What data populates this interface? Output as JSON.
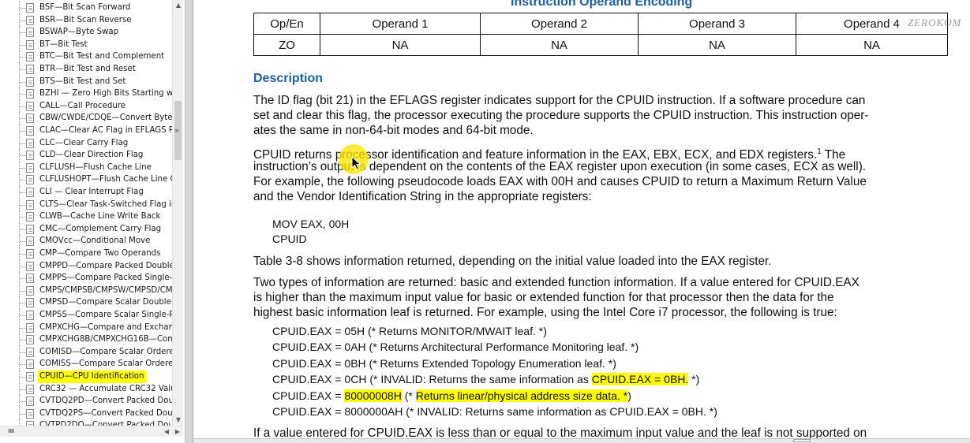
{
  "sidebar": {
    "items": [
      {
        "label": "BSF—Bit Scan Forward"
      },
      {
        "label": "BSR—Bit Scan Reverse"
      },
      {
        "label": "BSWAP—Byte Swap"
      },
      {
        "label": "BT—Bit Test"
      },
      {
        "label": "BTC—Bit Test and Complement"
      },
      {
        "label": "BTR—Bit Test and Reset"
      },
      {
        "label": "BTS—Bit Test and Set"
      },
      {
        "label": "BZHI — Zero High Bits Starting with"
      },
      {
        "label": "CALL—Call Procedure"
      },
      {
        "label": "CBW/CWDE/CDQE—Convert Byte t"
      },
      {
        "label": "CLAC—Clear AC Flag in EFLAGS Reg"
      },
      {
        "label": "CLC—Clear Carry Flag"
      },
      {
        "label": "CLD—Clear Direction Flag"
      },
      {
        "label": "CLFLUSH—Flush Cache Line"
      },
      {
        "label": "CLFLUSHOPT—Flush Cache Line Op"
      },
      {
        "label": "CLI — Clear Interrupt Flag"
      },
      {
        "label": "CLTS—Clear Task-Switched Flag in"
      },
      {
        "label": "CLWB—Cache Line Write Back"
      },
      {
        "label": "CMC—Complement Carry Flag"
      },
      {
        "label": "CMOVcc—Conditional Move"
      },
      {
        "label": "CMP—Compare Two Operands"
      },
      {
        "label": "CMPPD—Compare Packed Double-P"
      },
      {
        "label": "CMPPS—Compare Packed Single-Pre"
      },
      {
        "label": "CMPS/CMPSB/CMPSW/CMPSD/CMPS"
      },
      {
        "label": "CMPSD—Compare Scalar Double-Pre"
      },
      {
        "label": "CMPSS—Compare Scalar Single-Prec"
      },
      {
        "label": "CMPXCHG—Compare and Exchange"
      },
      {
        "label": "CMPXCHG8B/CMPXCHG16B—Compa"
      },
      {
        "label": "COMISD—Compare Scalar Ordered I"
      },
      {
        "label": "COMISS—Compare Scalar Ordered S"
      },
      {
        "label": "CPUID—CPU Identification",
        "selected": true
      },
      {
        "label": "CRC32 — Accumulate CRC32 Value"
      },
      {
        "label": "CVTDQ2PD—Convert Packed Doubl"
      },
      {
        "label": "CVTDQ2PS—Convert Packed Doubl"
      },
      {
        "label": "CVTPD2DQ—Convert Packed Doub"
      }
    ],
    "scroll_glyphs": {
      "up": "▲",
      "down": "▼",
      "left": "◀",
      "right": "▶",
      "grip_v": "≡",
      "grip_h": "ⅡⅡⅡ"
    }
  },
  "doc": {
    "section_heading": "Instruction Operand Encoding",
    "watermark": "ZEROKOM",
    "operand_table": {
      "header": [
        "Op/En",
        "Operand 1",
        "Operand 2",
        "Operand 3",
        "Operand 4"
      ],
      "row": [
        "ZO",
        "NA",
        "NA",
        "NA",
        "NA"
      ]
    },
    "description_heading": "Description",
    "para1": [
      "The ID flag (bit 21) in the EFLAGS register indicates support for the CPUID instruction. If a software procedure can",
      "set and clear this flag, the processor executing the procedure supports the CPUID instruction. This instruction oper-",
      "ates the same in non-64-bit modes and 64-bit mode."
    ],
    "para2_line1": "CPUID returns processor identification and feature information in the EAX, EBX, ECX, and EDX registers.",
    "para2_footnote": "1",
    "para2_line1_tail": " The",
    "para2_rest": [
      "instruction’s output is dependent on the contents of the EAX register upon execution (in some cases, ECX as well).",
      "For example, the following pseudocode loads EAX with 00H and causes CPUID to return a Maximum Return Value",
      "and the Vendor Identification String in the appropriate registers:"
    ],
    "code1": [
      "MOV EAX, 00H",
      "CPUID"
    ],
    "para3": "Table 3-8 shows information returned, depending on the initial value loaded into the EAX register.",
    "para4": [
      "Two types of information are returned: basic and extended function information. If a value entered for CPUID.EAX",
      "is higher than the maximum input value for basic or extended function for that processor then the data for the",
      "highest basic information leaf is returned. For example, using the Intel Core i7 processor, the following is true:"
    ],
    "code2": [
      "CPUID.EAX = 05H (* Returns MONITOR/MWAIT leaf. *)",
      "CPUID.EAX = 0AH (* Returns Architectural Performance Monitoring leaf. *)",
      "CPUID.EAX = 0BH (* Returns Extended Topology Enumeration leaf. *)"
    ],
    "code2_line4_prefix": "CPUID.EAX = 0CH (* INVALID: Returns the same information as ",
    "code2_line4_hl": "CPUID.EAX = 0BH.",
    "code2_line4_suffix": " *)",
    "code2_line5_prefix": "CPUID.EAX = ",
    "code2_line5_hl1": "80000008H",
    "code2_line5_mid": " (* ",
    "code2_line5_hl2": "Returns linear/physical address size data. *",
    "code2_line5_suffix": ")",
    "code2_line6": "CPUID.EAX = 8000000AH (* INVALID: Returns same information as CPUID.EAX = 0BH. *)",
    "para5": "If a value entered for CPUID.EAX is less than or equal to the maximum input value and the leaf is not supported on"
  },
  "colors": {
    "heading_blue": "#1f5fa3",
    "highlight": "#ffff00",
    "cursor_halo": "#ffe600"
  },
  "icons": {
    "bookmark": "bookmark-page-icon",
    "cursor": "mouse-pointer-icon"
  }
}
